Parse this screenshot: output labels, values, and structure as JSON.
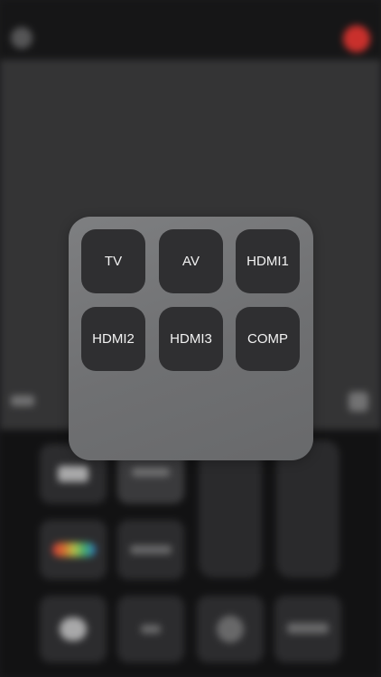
{
  "input_dialog": {
    "options": [
      "TV",
      "AV",
      "HDMI1",
      "HDMI2",
      "HDMI3",
      "COMP"
    ]
  },
  "colors": {
    "overlay_bg": "#7a7b7d",
    "input_button_bg": "#2f2f31",
    "input_button_text": "#f2f2f2",
    "power_red": "#c9302c"
  },
  "icons": {
    "top_left": "settings-icon",
    "top_right": "power-icon"
  }
}
